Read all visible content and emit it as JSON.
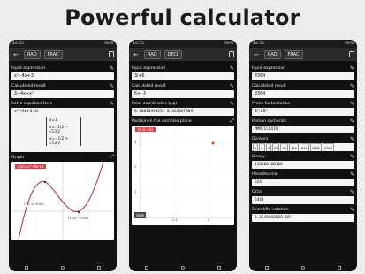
{
  "headline": "Powerful calculator",
  "phones": [
    {
      "status": {
        "time": "20:55",
        "battery": "90%"
      },
      "toolbar": {
        "mode": "RAD",
        "format": "FRAC"
      },
      "input_title": "Input expression",
      "input_value": "x³−4x+3",
      "calc_title": "Calculated result",
      "calc_value": "3−4x+x³",
      "solve_title": "Solve equation for x",
      "solve_equation": "x³−4x+3=0",
      "solutions": [
        "x=1",
        "x=−1/2 − √13/2",
        "x=−1/2 + √13/2"
      ],
      "graph_title": "Graph",
      "graph_legend": "y(x)=x³−4x+3",
      "graph_points": [
        "(−1.15,6.08)",
        "(1.15,−0.08)"
      ]
    },
    {
      "status": {
        "time": "20:55",
        "battery": "90%"
      },
      "toolbar": {
        "mode": "RAD",
        "format": "DECI"
      },
      "input_title": "Input expression",
      "input_value": "3i+6",
      "calc_title": "Calculated result",
      "calc_value": "6+i·3",
      "polar_title": "Polar coordinates (r,φ)",
      "polar_value": "6.7082039325, 0.463647609",
      "plane_title": "Position in the complex plane",
      "plane_legend": "(6.0,3.0)",
      "plane_x_ticks": [
        "2.5",
        "5"
      ],
      "plane_y_ticks": [
        "3",
        "2",
        "1"
      ],
      "hide_label": "Hide"
    },
    {
      "status": {
        "time": "20:55",
        "battery": "90%"
      },
      "toolbar": {
        "mode": "RAD",
        "format": "FRAC"
      },
      "input_title": "Input expression",
      "input_value": "3364",
      "calc_title": "Calculated result",
      "calc_value": "3364",
      "prime_title": "Prime factorization",
      "prime_value": "2²·29²",
      "roman_title": "Roman numerals",
      "roman_value": "MMMCCCLXIV",
      "div_title": "Divisors",
      "divisors": [
        "1",
        "2",
        "4",
        "29",
        "58",
        "116",
        "841",
        "1682",
        "3364"
      ],
      "binary_title": "Binary",
      "binary_value": "110100100100",
      "hex_title": "Hexadecimal",
      "hex_value": "D24",
      "octal_title": "Octal",
      "octal_value": "6444",
      "sci_title": "Scientific notation",
      "sci_value": "3.3640000000·10³"
    }
  ]
}
